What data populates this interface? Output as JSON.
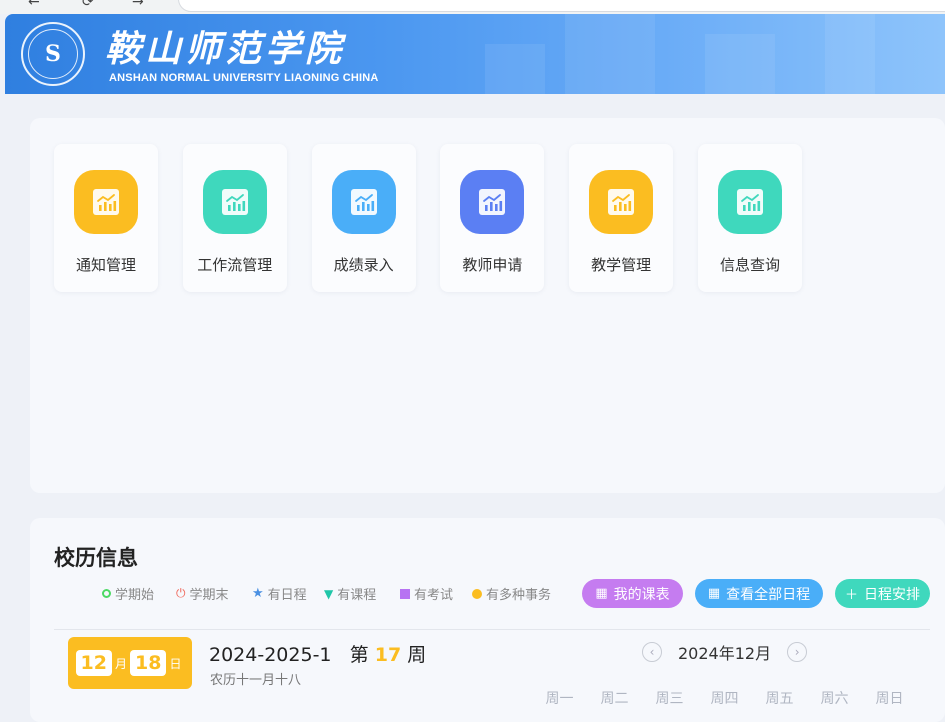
{
  "header": {
    "seal_glyph": "S",
    "school_name": "鞍山师范学院",
    "school_name_en": "ANSHAN NORMAL UNIVERSITY LIAONING CHINA"
  },
  "apps": [
    {
      "label": "通知管理",
      "color": "#fbbd21",
      "icon": "chart-icon"
    },
    {
      "label": "工作流管理",
      "color": "#3fd8bd",
      "icon": "chart-icon"
    },
    {
      "label": "成绩录入",
      "color": "#4aaef8",
      "icon": "chart-icon"
    },
    {
      "label": "教师申请",
      "color": "#5b7ff3",
      "icon": "chart-icon"
    },
    {
      "label": "教学管理",
      "color": "#fbbd21",
      "icon": "chart-icon"
    },
    {
      "label": "信息查询",
      "color": "#3fd8bd",
      "icon": "chart-icon"
    }
  ],
  "calendar": {
    "title": "校历信息",
    "legend": [
      {
        "label": "学期始",
        "color": "#4cd964",
        "icon": "ring-icon"
      },
      {
        "label": "学期末",
        "color": "#f06a5d",
        "icon": "power-icon"
      },
      {
        "label": "有日程",
        "color": "#4a90e2",
        "icon": "star-icon"
      },
      {
        "label": "有课程",
        "color": "#20c6a8",
        "icon": "triangle-icon"
      },
      {
        "label": "有考试",
        "color": "#b773f2",
        "icon": "square-icon"
      },
      {
        "label": "有多种事务",
        "color": "#fbbd21",
        "icon": "dot-icon"
      }
    ],
    "buttons": {
      "my_schedule": "我的课表",
      "all_events": "查看全部日程",
      "add_event": "日程安排"
    },
    "today": {
      "month": "12",
      "month_unit": "月",
      "day": "18",
      "day_unit": "日"
    },
    "term": "2024-2025-1",
    "week_prefix": "第",
    "week_num": "17",
    "week_suffix": "周",
    "lunar": "农历十一月十八",
    "month_label": "2024年12月",
    "weekdays": [
      "周一",
      "周二",
      "周三",
      "周四",
      "周五",
      "周六",
      "周日"
    ]
  }
}
